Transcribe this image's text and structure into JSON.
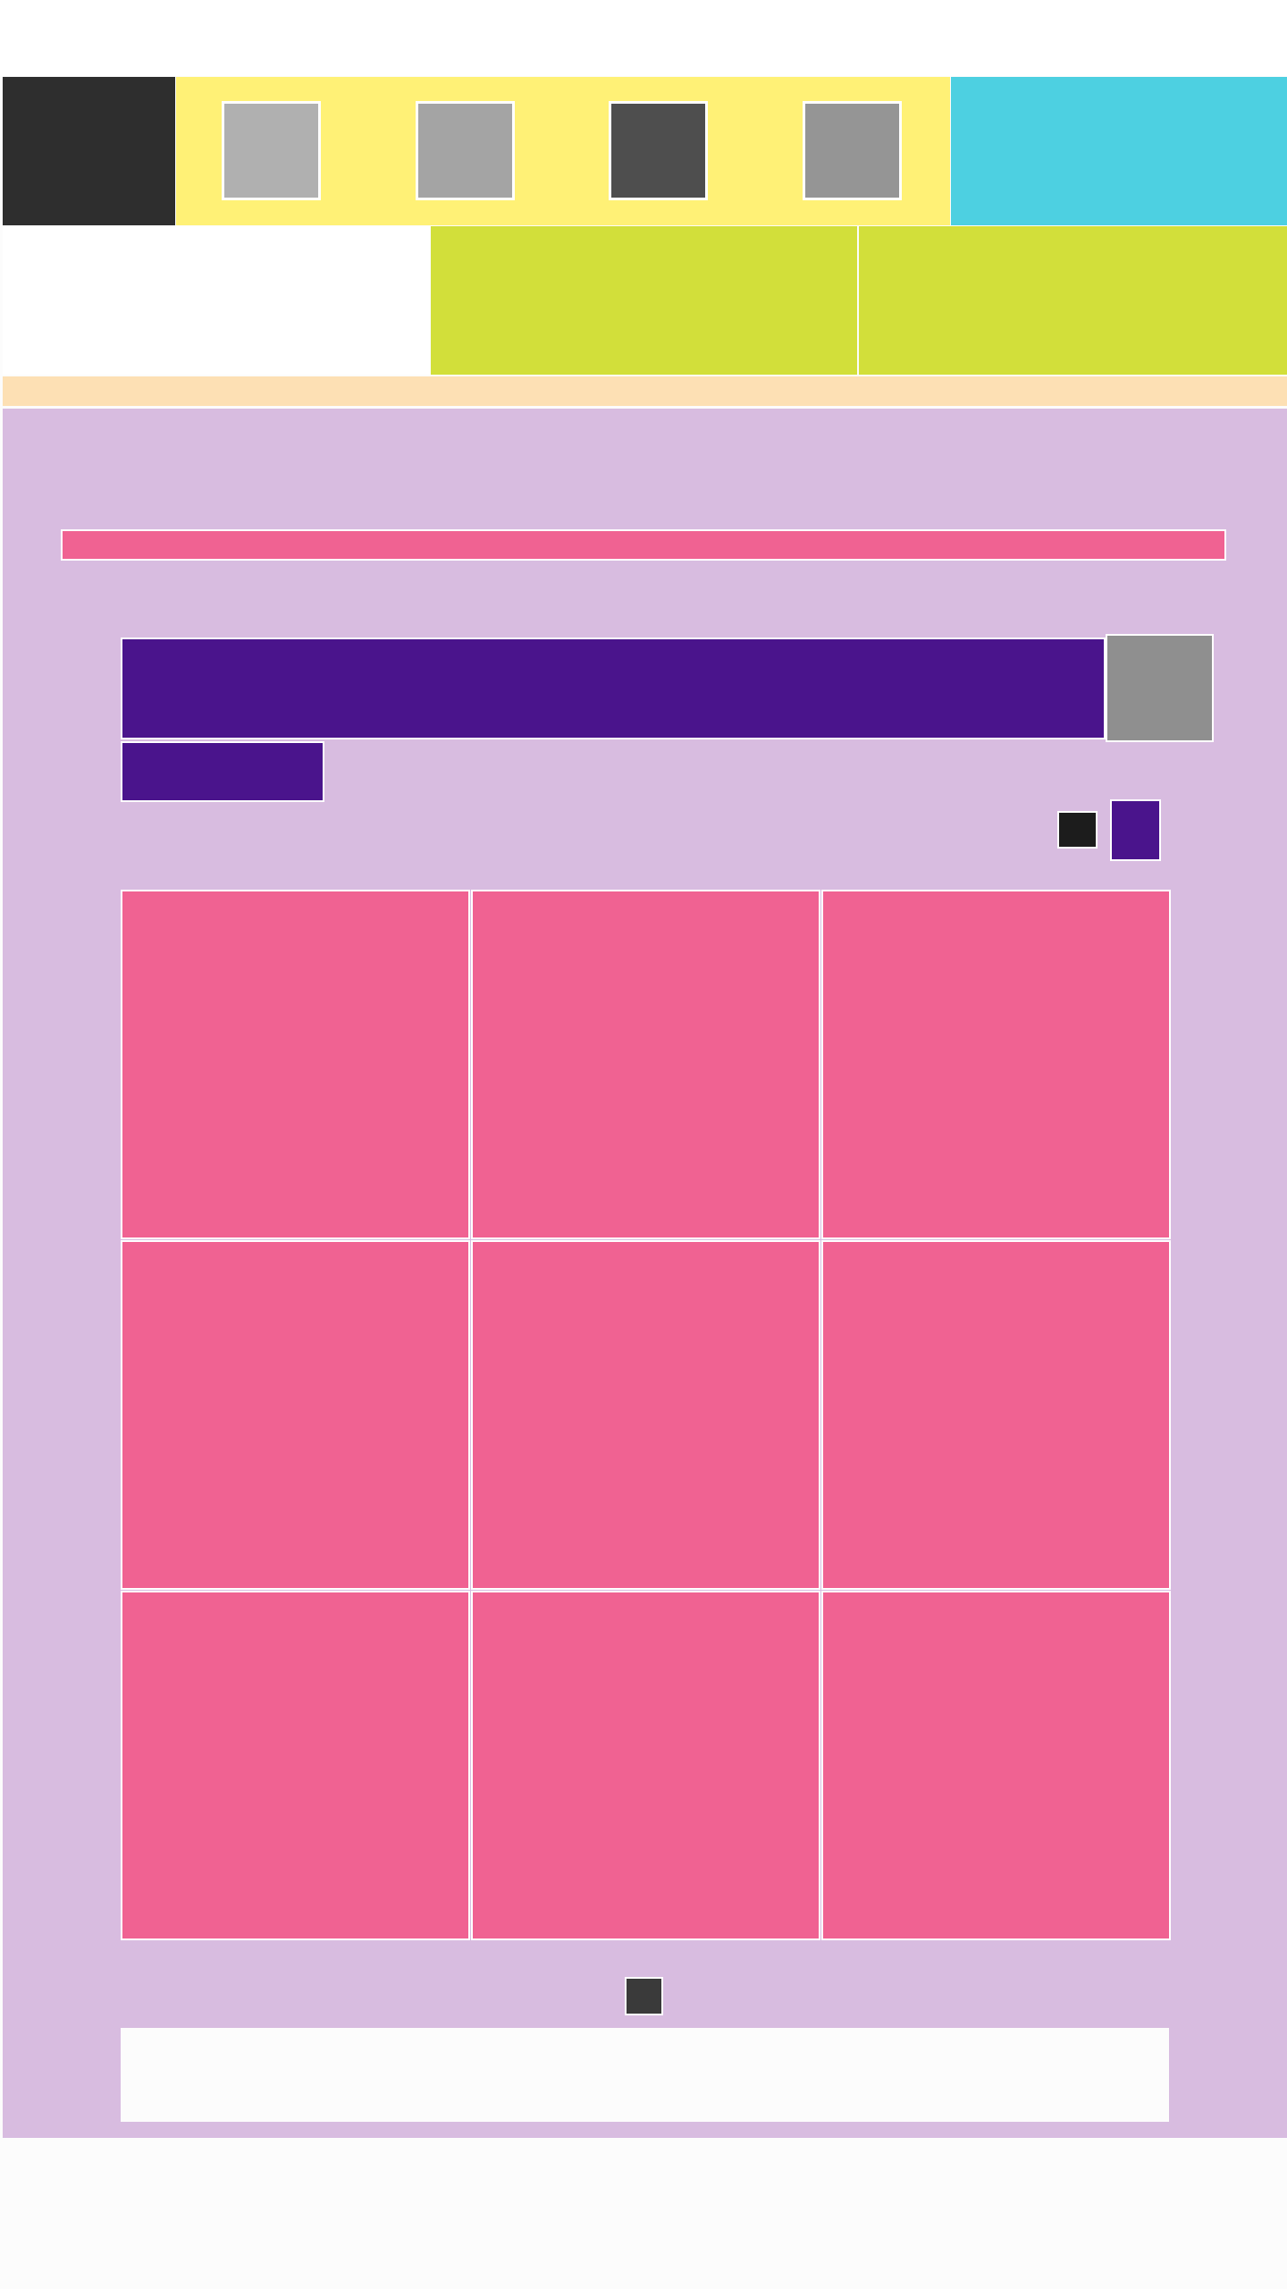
{
  "header": {
    "logo": {
      "icon": "logo-block",
      "color": "#2e2e2e"
    },
    "nav_items": [
      {
        "icon": "nav-icon-1",
        "color": "#b0b0b0"
      },
      {
        "icon": "nav-icon-2",
        "color": "#a4a4a4"
      },
      {
        "icon": "nav-icon-3",
        "color": "#4e4e4e"
      },
      {
        "icon": "nav-icon-4",
        "color": "#959595"
      }
    ],
    "accent_color": "#4dd0e1",
    "nav_bar_color": "#fff176"
  },
  "subheader": {
    "panel_color": "#d2df3a"
  },
  "banner_color": "#fde0b4",
  "main": {
    "background_color": "#d8bce0",
    "strip_color": "#f06292",
    "title": "",
    "subtitle": "",
    "title_color": "#4a148c",
    "grid": {
      "rows": 3,
      "cols": 3,
      "tile_color": "#f06292",
      "tiles": [
        "",
        "",
        "",
        "",
        "",
        "",
        "",
        "",
        ""
      ]
    },
    "pager": {
      "icon": "page-dot-icon",
      "color": "#3a3a3a"
    },
    "footer_text": ""
  }
}
